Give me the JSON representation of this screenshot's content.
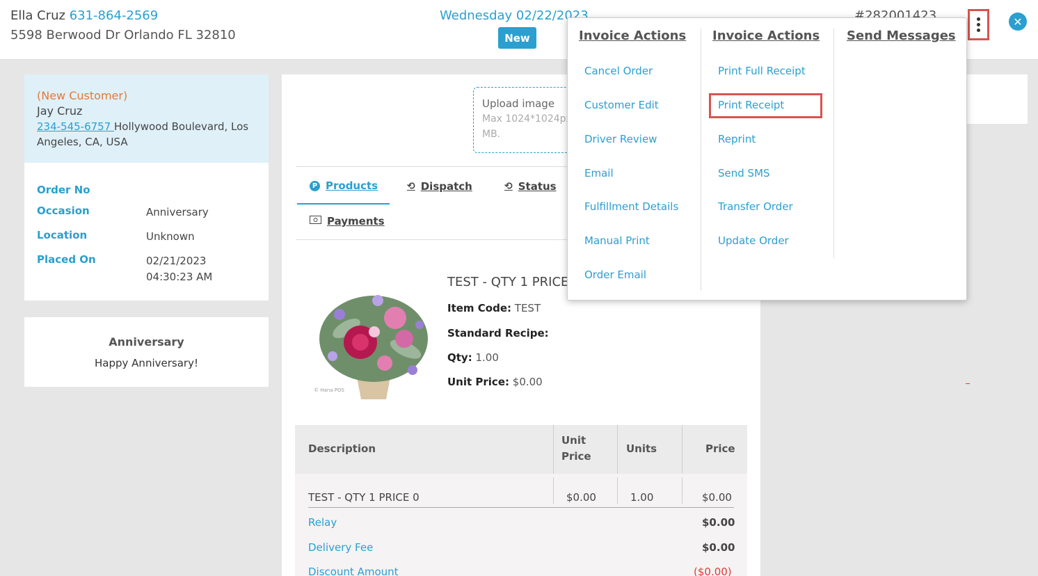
{
  "header": {
    "customer_name": "Ella Cruz",
    "customer_phone": "631-864-2569",
    "customer_address": "5598 Berwood Dr Orlando FL 32810",
    "date": "Wednesday 02/22/2023",
    "status_badge": "New",
    "order_number": "#282001423"
  },
  "customer_card": {
    "new_label": "(New Customer)",
    "name": "Jay Cruz",
    "phone": "234-545-6757 ",
    "address": "Hollywood Boulevard, Los Angeles, CA, USA"
  },
  "order_info": [
    {
      "label": "Order No",
      "value": ""
    },
    {
      "label": "Occasion",
      "value": "Anniversary"
    },
    {
      "label": "Location",
      "value": "Unknown"
    },
    {
      "label": "Placed On",
      "value": "02/21/2023 04:30:23 AM"
    }
  ],
  "occasion_card": {
    "title": "Anniversary",
    "message": "Happy Anniversary!"
  },
  "upload": {
    "label": "Upload image",
    "hint": "Max 1024*1024px, 2 MB."
  },
  "tabs": [
    {
      "label": "Products",
      "icon": "p-circle-icon"
    },
    {
      "label": "Dispatch",
      "icon": "history-icon"
    },
    {
      "label": "Status",
      "icon": "history-icon"
    },
    {
      "label": "Payments",
      "icon": "money-icon"
    }
  ],
  "product": {
    "title": "TEST - QTY 1 PRICE 0",
    "item_code_label": "Item Code:",
    "item_code": "TEST",
    "recipe_label": "Standard Recipe:",
    "qty_label": "Qty:",
    "qty": "1.00",
    "unit_price_label": "Unit Price:",
    "unit_price": "$0.00",
    "image_watermark": "© Hana POS"
  },
  "line_table": {
    "headers": {
      "description": "Description",
      "unit_price": "Unit Price",
      "units": "Units",
      "price": "Price"
    },
    "row": {
      "description": "TEST - QTY 1 PRICE 0",
      "unit_price": "$0.00",
      "units": "1.00",
      "price": "$0.00"
    },
    "relay_label": "Relay",
    "relay_value": "$0.00",
    "delivery_label": "Delivery Fee",
    "delivery_value": "$0.00",
    "discount_label": "Discount Amount",
    "discount_value": "($0.00)"
  },
  "dropdown": {
    "col1_title": "Invoice Actions",
    "col1_items": [
      "Cancel Order",
      "Customer Edit",
      "Driver Review",
      "Email",
      "Fulfillment Details",
      "Manual Print",
      "Order Email"
    ],
    "col2_title": "Invoice Actions",
    "col2_items": [
      "Print Full Receipt",
      "Print Receipt",
      "Reprint",
      "Send SMS",
      "Transfer Order",
      "Update Order"
    ],
    "col3_title": "Send Messages",
    "highlighted_item": "Print Receipt"
  },
  "colors": {
    "accent": "#2a9fd0",
    "highlight": "#d9534f",
    "new_customer": "#e07b3a",
    "negative": "#e03a3a"
  }
}
